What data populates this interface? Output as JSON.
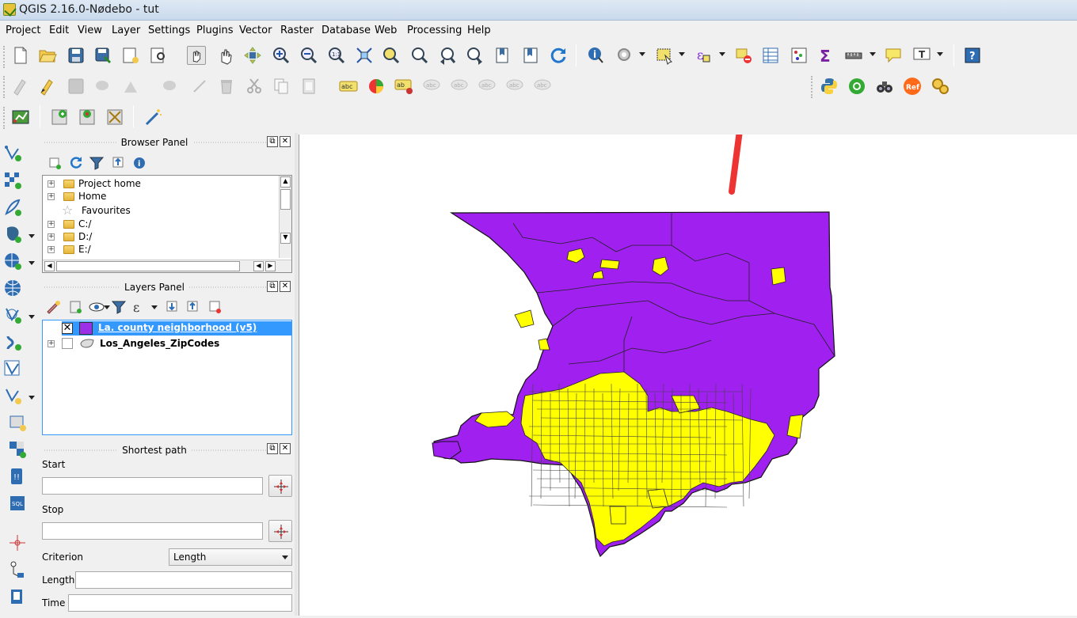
{
  "window": {
    "title": "QGIS 2.16.0-Nødebo - tut"
  },
  "menu": [
    "Project",
    "Edit",
    "View",
    "Layer",
    "Settings",
    "Plugins",
    "Vector",
    "Raster",
    "Database",
    "Web",
    "Processing",
    "Help"
  ],
  "browser_panel": {
    "title": "Browser Panel",
    "items": [
      "Project home",
      "Home",
      "Favourites",
      "C:/",
      "D:/",
      "E:/"
    ]
  },
  "layers_panel": {
    "title": "Layers Panel",
    "layers": [
      {
        "name": "La. county neighborhood (v5)",
        "checked": true,
        "selected": true,
        "color": "#9b30e6"
      },
      {
        "name": "Los_Angeles_ZipCodes",
        "checked": false,
        "selected": false
      }
    ]
  },
  "shortest_path": {
    "title": "Shortest path",
    "start_label": "Start",
    "start_value": "",
    "stop_label": "Stop",
    "stop_value": "",
    "criterion_label": "Criterion",
    "criterion_value": "Length",
    "length_label": "Length",
    "length_value": "",
    "time_label": "Time",
    "time_value": ""
  },
  "map": {
    "fill_purple": "#a020f0",
    "fill_yellow": "#ffff00",
    "annotation_arrow_color": "#ee3333"
  },
  "colors": {
    "selection": "#3399ff"
  }
}
